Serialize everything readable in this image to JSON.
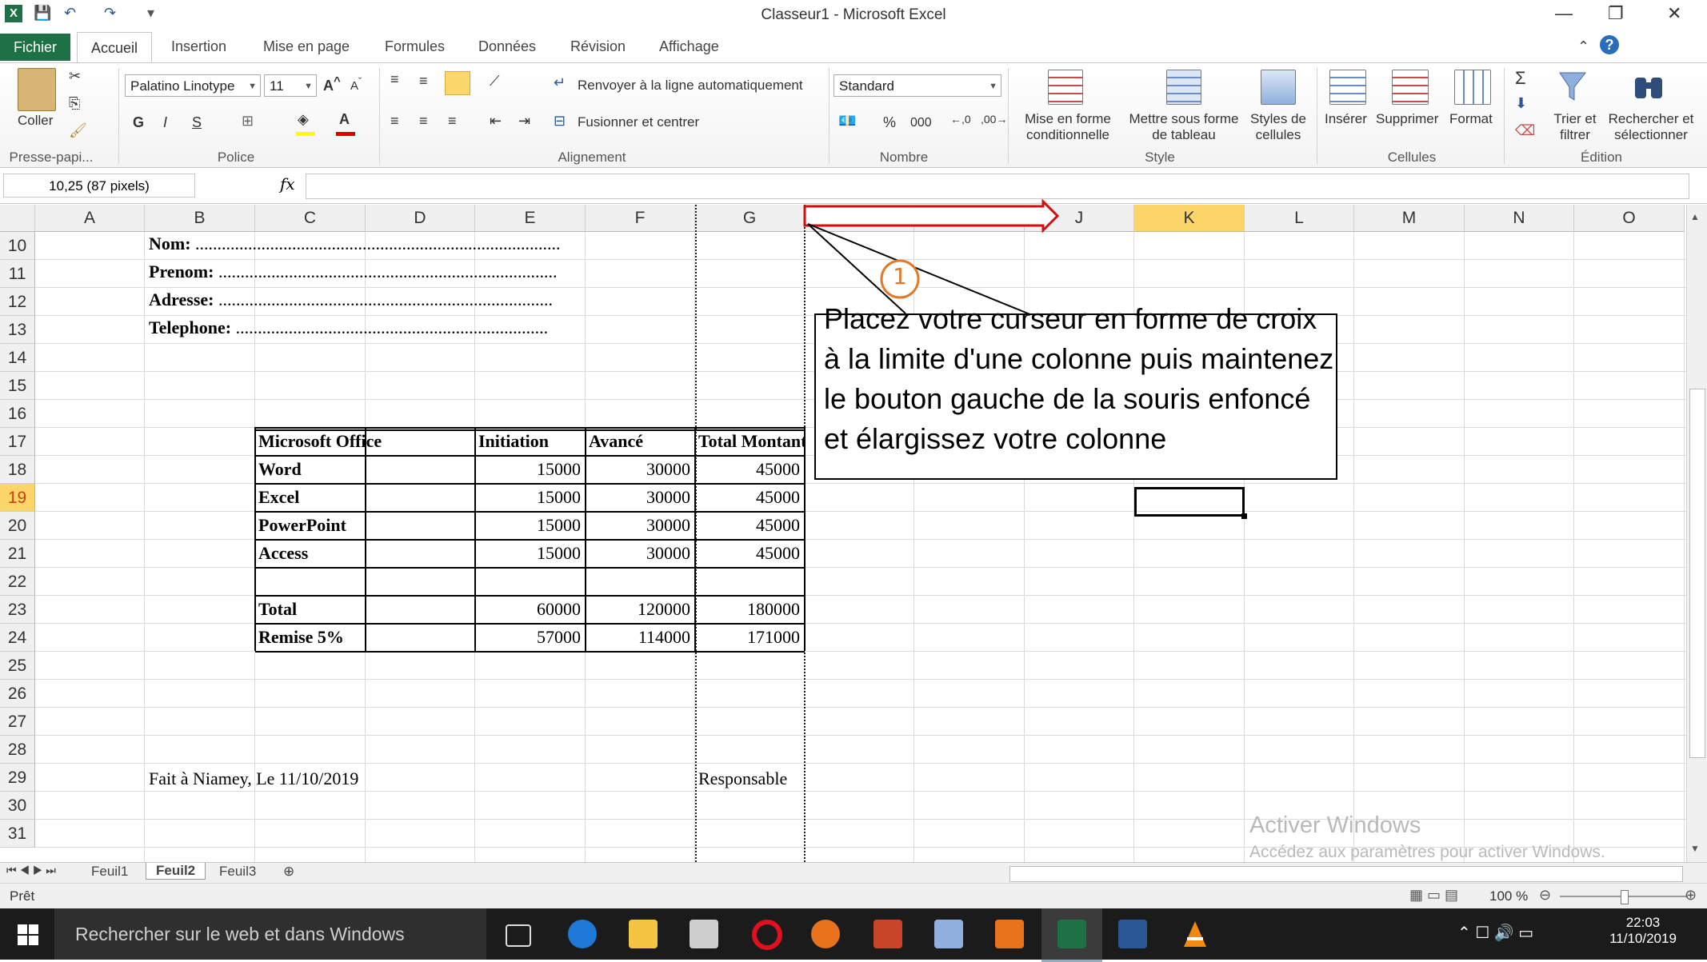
{
  "window": {
    "title": "Classeur1 - Microsoft Excel",
    "controls": {
      "minimize": "—",
      "restore": "❐",
      "close": "✕"
    }
  },
  "quick_access": {
    "save": "💾",
    "undo": "↶",
    "redo": "↷"
  },
  "tabs": {
    "file": "Fichier",
    "items": [
      "Accueil",
      "Insertion",
      "Mise en page",
      "Formules",
      "Données",
      "Révision",
      "Affichage"
    ]
  },
  "ribbon": {
    "clipboard": {
      "paste": "Coller",
      "label": "Presse-papi..."
    },
    "font": {
      "name": "Palatino Linotype",
      "size": "11",
      "bold": "G",
      "italic": "I",
      "underline": "S",
      "label": "Police"
    },
    "alignment": {
      "wrap": "Renvoyer à la ligne automatiquement",
      "merge": "Fusionner et centrer",
      "label": "Alignement"
    },
    "number": {
      "format": "Standard",
      "percent": "%",
      "thousands": "000",
      "label": "Nombre"
    },
    "style": {
      "cond_line1": "Mise en forme",
      "cond_line2": "conditionnelle",
      "table_line1": "Mettre sous forme",
      "table_line2": "de tableau",
      "styles_line1": "Styles de",
      "styles_line2": "cellules",
      "label": "Style"
    },
    "cells": {
      "insert": "Insérer",
      "delete": "Supprimer",
      "format": "Format",
      "label": "Cellules"
    },
    "editing": {
      "sort_line1": "Trier et",
      "sort_line2": "filtrer",
      "find_line1": "Rechercher et",
      "find_line2": "sélectionner",
      "label": "Édition"
    }
  },
  "formula_bar": {
    "name_box": "10,25 (87 pixels)",
    "fx": "fx",
    "value": ""
  },
  "columns": [
    "A",
    "B",
    "C",
    "D",
    "E",
    "F",
    "G",
    "H",
    "I",
    "J",
    "K",
    "L",
    "M",
    "N",
    "O"
  ],
  "rows": [
    "10",
    "11",
    "12",
    "13",
    "14",
    "15",
    "16",
    "17",
    "18",
    "19",
    "20",
    "21",
    "22",
    "23",
    "24",
    "25",
    "26",
    "27",
    "28",
    "29",
    "30",
    "31"
  ],
  "form_fields": [
    {
      "label": "Nom: ",
      "dots": "..................................................................................."
    },
    {
      "label": "Prenom: ",
      "dots": "............................................................................."
    },
    {
      "label": "Adresse: ",
      "dots": "............................................................................"
    },
    {
      "label": "Telephone: ",
      "dots": "......................................................................."
    }
  ],
  "table": {
    "headers": [
      "Microsoft Office",
      "Initiation",
      "Avancé",
      "Total Montant"
    ],
    "rows": [
      {
        "name": "Word",
        "initiation": "15000",
        "avance": "30000",
        "total": "45000"
      },
      {
        "name": "Excel",
        "initiation": "15000",
        "avance": "30000",
        "total": "45000"
      },
      {
        "name": "PowerPoint",
        "initiation": "15000",
        "avance": "30000",
        "total": "45000"
      },
      {
        "name": "Access",
        "initiation": "15000",
        "avance": "30000",
        "total": "45000"
      },
      {
        "name": "",
        "initiation": "",
        "avance": "",
        "total": ""
      },
      {
        "name": "Total",
        "initiation": "60000",
        "avance": "120000",
        "total": "180000"
      },
      {
        "name": "Remise 5%",
        "initiation": "57000",
        "avance": "114000",
        "total": "171000"
      }
    ]
  },
  "footer": {
    "place_date": "Fait à Niamey, Le 11/10/2019",
    "signature": "Responsable"
  },
  "annotation": {
    "step": "1",
    "text": "Placez votre curseur en forme de croix à la limite d'une colonne puis maintenez le bouton gauche de la souris enfoncé et élargissez votre colonne"
  },
  "watermark": {
    "line1": "Activer Windows",
    "line2": "Accédez aux paramètres pour activer Windows."
  },
  "sheet_tabs": [
    "Feuil1",
    "Feuil2",
    "Feuil3"
  ],
  "active_sheet": "Feuil2",
  "status": {
    "ready": "Prêt",
    "zoom": "100 %"
  },
  "taskbar": {
    "search": "Rechercher sur le web et dans Windows",
    "time": "22:03",
    "date": "11/10/2019"
  }
}
